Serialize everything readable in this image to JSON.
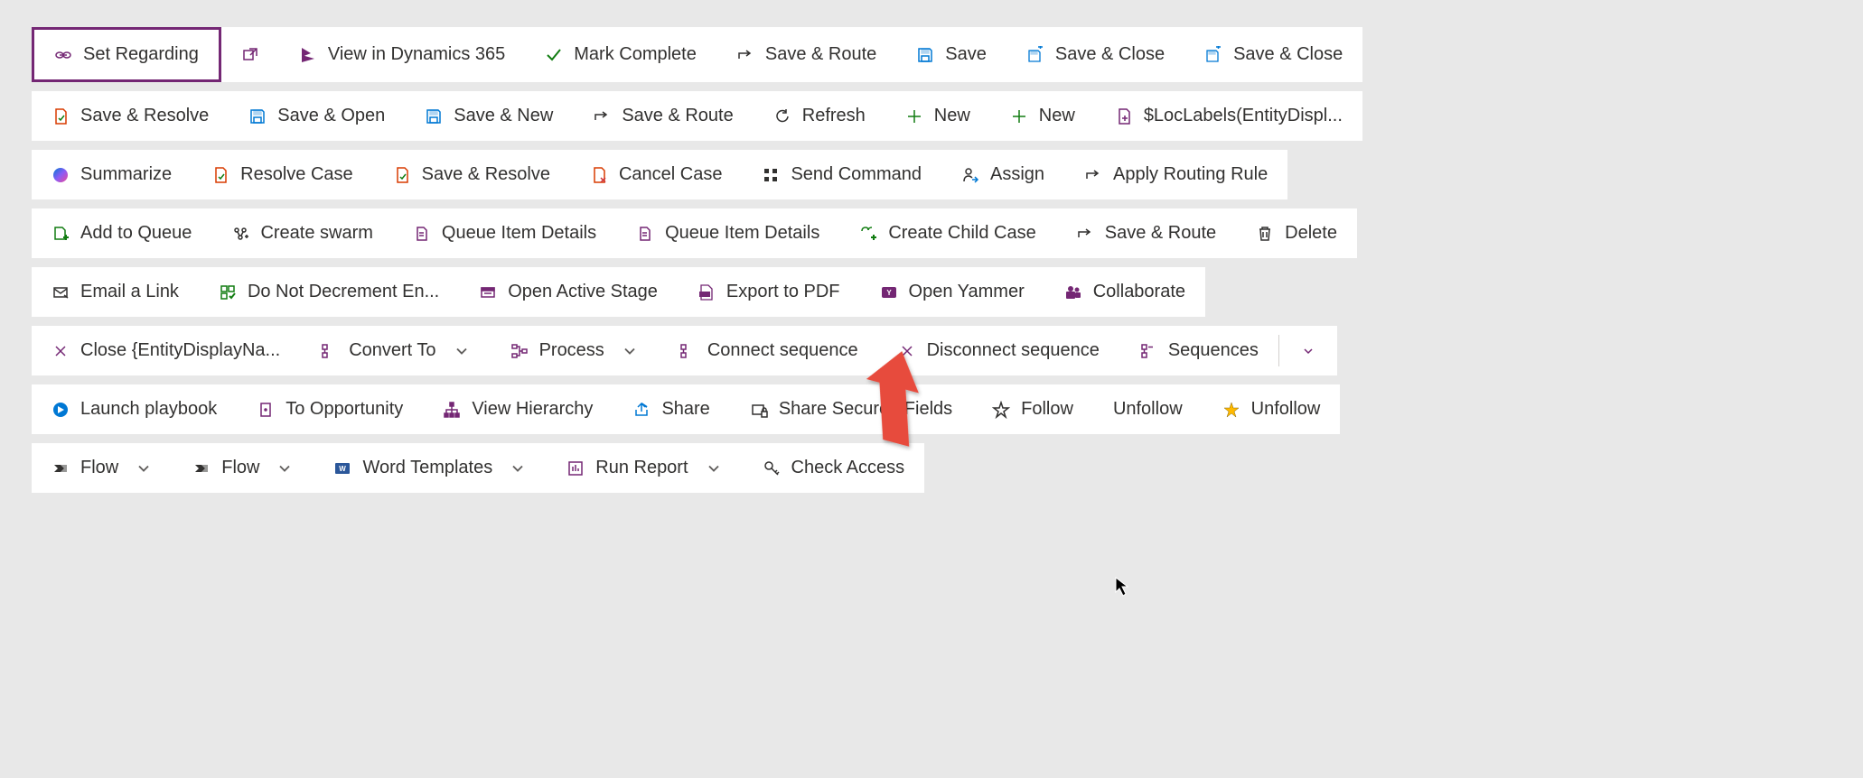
{
  "rows": [
    {
      "items": [
        {
          "name": "set-regarding-button",
          "label": "Set Regarding",
          "icon": "link",
          "iconColor": "#742774",
          "highlighted": true
        },
        {
          "name": "popout-button",
          "label": "",
          "icon": "popout",
          "iconColor": "#742774"
        },
        {
          "name": "view-in-dynamics-button",
          "label": "View in Dynamics 365",
          "icon": "dynamics",
          "iconColor": "#742774"
        },
        {
          "name": "mark-complete-button",
          "label": "Mark Complete",
          "icon": "check",
          "iconColor": "#107C10"
        },
        {
          "name": "save-route-button-1",
          "label": "Save & Route",
          "icon": "route-arrow",
          "iconColor": "#323130"
        },
        {
          "name": "save-button",
          "label": "Save",
          "icon": "save",
          "iconColor": "#0078D4"
        },
        {
          "name": "save-close-button-1",
          "label": "Save & Close",
          "icon": "save-close",
          "iconColor": "#0078D4"
        },
        {
          "name": "save-close-button-2",
          "label": "Save & Close",
          "icon": "save-close",
          "iconColor": "#0078D4"
        }
      ]
    },
    {
      "items": [
        {
          "name": "save-resolve-button-1",
          "label": "Save & Resolve",
          "icon": "page-check",
          "iconColor": "#D83B01"
        },
        {
          "name": "save-open-button",
          "label": "Save & Open",
          "icon": "save",
          "iconColor": "#0078D4"
        },
        {
          "name": "save-new-button",
          "label": "Save & New",
          "icon": "save",
          "iconColor": "#0078D4"
        },
        {
          "name": "save-route-button-2",
          "label": "Save & Route",
          "icon": "route-arrow",
          "iconColor": "#323130"
        },
        {
          "name": "refresh-button",
          "label": "Refresh",
          "icon": "refresh",
          "iconColor": "#323130"
        },
        {
          "name": "new-button-1",
          "label": "New",
          "icon": "plus",
          "iconColor": "#107C10"
        },
        {
          "name": "new-button-2",
          "label": "New",
          "icon": "plus",
          "iconColor": "#107C10"
        },
        {
          "name": "loc-labels-button",
          "label": "$LocLabels(EntityDispl...",
          "icon": "page-plus",
          "iconColor": "#742774"
        }
      ]
    },
    {
      "items": [
        {
          "name": "summarize-button",
          "label": "Summarize",
          "icon": "copilot",
          "iconColor": "#0078D4"
        },
        {
          "name": "resolve-case-button",
          "label": "Resolve Case",
          "icon": "page-check",
          "iconColor": "#D83B01"
        },
        {
          "name": "save-resolve-button-2",
          "label": "Save & Resolve",
          "icon": "page-check",
          "iconColor": "#D83B01"
        },
        {
          "name": "cancel-case-button",
          "label": "Cancel Case",
          "icon": "page-x",
          "iconColor": "#D83B01"
        },
        {
          "name": "send-command-button",
          "label": "Send Command",
          "icon": "command-grid",
          "iconColor": "#323130"
        },
        {
          "name": "assign-button",
          "label": "Assign",
          "icon": "person-arrow",
          "iconColor": "#323130"
        },
        {
          "name": "apply-routing-button",
          "label": "Apply Routing Rule",
          "icon": "route-arrow",
          "iconColor": "#323130"
        }
      ]
    },
    {
      "items": [
        {
          "name": "add-to-queue-button",
          "label": "Add to Queue",
          "icon": "queue-add",
          "iconColor": "#107C10"
        },
        {
          "name": "create-swarm-button",
          "label": "Create swarm",
          "icon": "swarm",
          "iconColor": "#323130"
        },
        {
          "name": "queue-details-button-1",
          "label": "Queue Item Details",
          "icon": "queue-page",
          "iconColor": "#742774"
        },
        {
          "name": "queue-details-button-2",
          "label": "Queue Item Details",
          "icon": "queue-page",
          "iconColor": "#742774"
        },
        {
          "name": "create-child-case-button",
          "label": "Create Child Case",
          "icon": "child-case",
          "iconColor": "#107C10"
        },
        {
          "name": "save-route-button-3",
          "label": "Save & Route",
          "icon": "route-arrow",
          "iconColor": "#323130"
        },
        {
          "name": "delete-button",
          "label": "Delete",
          "icon": "trash",
          "iconColor": "#323130"
        }
      ]
    },
    {
      "items": [
        {
          "name": "email-link-button",
          "label": "Email a Link",
          "icon": "mail",
          "iconColor": "#323130"
        },
        {
          "name": "do-not-decrement-button",
          "label": "Do Not Decrement En...",
          "icon": "grid-check",
          "iconColor": "#107C10"
        },
        {
          "name": "open-active-stage-button",
          "label": "Open Active Stage",
          "icon": "stage",
          "iconColor": "#742774"
        },
        {
          "name": "export-pdf-button",
          "label": "Export to PDF",
          "icon": "pdf",
          "iconColor": "#742774"
        },
        {
          "name": "open-yammer-button",
          "label": "Open Yammer",
          "icon": "yammer",
          "iconColor": "#742774"
        },
        {
          "name": "collaborate-button",
          "label": "Collaborate",
          "icon": "teams",
          "iconColor": "#742774"
        }
      ]
    },
    {
      "items": [
        {
          "name": "close-entity-button",
          "label": "Close {EntityDisplayNa...",
          "icon": "x",
          "iconColor": "#742774"
        },
        {
          "name": "convert-to-button",
          "label": "Convert To",
          "icon": "convert",
          "iconColor": "#742774",
          "dropdown": true
        },
        {
          "name": "process-button",
          "label": "Process",
          "icon": "process",
          "iconColor": "#742774",
          "dropdown": true
        },
        {
          "name": "connect-sequence-button",
          "label": "Connect sequence",
          "icon": "convert",
          "iconColor": "#742774"
        },
        {
          "name": "disconnect-sequence-button",
          "label": "Disconnect sequence",
          "icon": "x",
          "iconColor": "#742774"
        },
        {
          "name": "sequences-button",
          "label": "Sequences",
          "icon": "sequences",
          "iconColor": "#742774",
          "dividerAfter": true
        },
        {
          "name": "sequences-dropdown",
          "label": "",
          "icon": "chevron-only",
          "iconColor": "#742774"
        }
      ]
    },
    {
      "items": [
        {
          "name": "launch-playbook-button",
          "label": "Launch playbook",
          "icon": "playbook",
          "iconColor": "#0078D4"
        },
        {
          "name": "to-opportunity-button",
          "label": "To Opportunity",
          "icon": "opportunity",
          "iconColor": "#742774"
        },
        {
          "name": "view-hierarchy-button",
          "label": "View Hierarchy",
          "icon": "hierarchy",
          "iconColor": "#742774"
        },
        {
          "name": "share-button",
          "label": "Share",
          "icon": "share",
          "iconColor": "#0078D4"
        },
        {
          "name": "share-secured-button",
          "label": "Share Secured Fields",
          "icon": "share-lock",
          "iconColor": "#323130"
        },
        {
          "name": "follow-button",
          "label": "Follow",
          "icon": "star",
          "iconColor": "#323130"
        },
        {
          "name": "unfollow-button-1",
          "label": "Unfollow",
          "icon": "",
          "iconColor": "#323130"
        },
        {
          "name": "unfollow-button-2",
          "label": "Unfollow",
          "icon": "star-fill",
          "iconColor": "#FFB900"
        }
      ]
    },
    {
      "items": [
        {
          "name": "flow-button-1",
          "label": "Flow",
          "icon": "flow",
          "iconColor": "#323130",
          "dropdown": true
        },
        {
          "name": "flow-button-2",
          "label": "Flow",
          "icon": "flow",
          "iconColor": "#323130",
          "dropdown": true
        },
        {
          "name": "word-templates-button",
          "label": "Word Templates",
          "icon": "word",
          "iconColor": "#2B579A",
          "dropdown": true
        },
        {
          "name": "run-report-button",
          "label": "Run Report",
          "icon": "report",
          "iconColor": "#742774",
          "dropdown": true
        },
        {
          "name": "check-access-button",
          "label": "Check Access",
          "icon": "key",
          "iconColor": "#323130"
        }
      ]
    }
  ]
}
